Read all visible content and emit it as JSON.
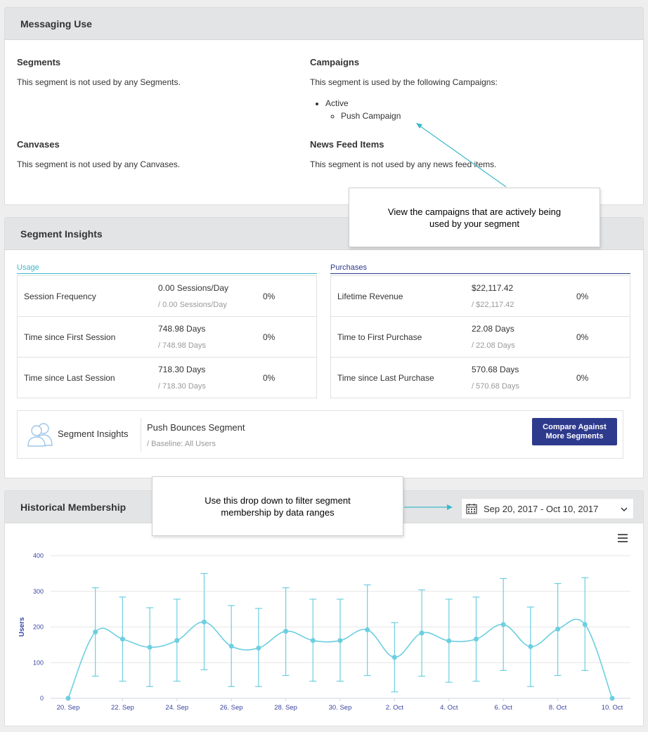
{
  "messaging_use": {
    "title": "Messaging Use",
    "segments": {
      "heading": "Segments",
      "text": "This segment is not used by any Segments."
    },
    "campaigns": {
      "heading": "Campaigns",
      "text": "This segment is used by the following Campaigns:",
      "status": "Active",
      "campaign_name": "Push Campaign"
    },
    "canvases": {
      "heading": "Canvases",
      "text": "This segment is not used by any Canvases."
    },
    "news_feed": {
      "heading": "News Feed Items",
      "text": "This segment is not used by any news feed items."
    }
  },
  "segment_insights": {
    "title": "Segment Insights",
    "usage_label": "Usage",
    "purchases_label": "Purchases",
    "usage_rows": [
      {
        "name": "Session Frequency",
        "value": "0.00 Sessions/Day",
        "baseline": "/ 0.00 Sessions/Day",
        "pct": "0%"
      },
      {
        "name": "Time since First Session",
        "value": "748.98 Days",
        "baseline": "/ 748.98 Days",
        "pct": "0%"
      },
      {
        "name": "Time since Last Session",
        "value": "718.30 Days",
        "baseline": "/ 718.30 Days",
        "pct": "0%"
      }
    ],
    "purchase_rows": [
      {
        "name": "Lifetime Revenue",
        "value": "$22,117.42",
        "baseline": "/ $22,117.42",
        "pct": "0%"
      },
      {
        "name": "Time to First Purchase",
        "value": "22.08 Days",
        "baseline": "/ 22.08 Days",
        "pct": "0%"
      },
      {
        "name": "Time since Last Purchase",
        "value": "570.68 Days",
        "baseline": "/ 570.68 Days",
        "pct": "0%"
      }
    ],
    "bar_label": "Segment Insights",
    "segment_name": "Push Bounces Segment",
    "baseline": "/ Baseline: All Users",
    "compare_button": "Compare Against More Segments"
  },
  "historical": {
    "title": "Historical Membership",
    "date_range": "Sep 20, 2017 - Oct 10, 2017"
  },
  "callouts": {
    "campaigns": "View the campaigns that are actively being used by your segment",
    "dropdown": "Use this drop down to filter segment membership by data ranges"
  },
  "icons": [
    "users-icon",
    "calendar-icon",
    "chevron-down-icon",
    "menu-icon"
  ],
  "colors": {
    "accent_teal": "#3bb9c9",
    "accent_navy": "#2e3a8c",
    "series": "#6ccfe0",
    "axis_text": "#3a45a0"
  },
  "chart_data": {
    "type": "line",
    "ylabel": "Users",
    "xlabel": "",
    "ylim": [
      0,
      400
    ],
    "yticks": [
      "0",
      "100",
      "200",
      "300",
      "400"
    ],
    "xticks": [
      "20. Sep",
      "22. Sep",
      "24. Sep",
      "26. Sep",
      "28. Sep",
      "30. Sep",
      "2. Oct",
      "4. Oct",
      "6. Oct",
      "8. Oct",
      "10. Oct"
    ],
    "x": [
      "Sep 20",
      "Sep 21",
      "Sep 22",
      "Sep 23",
      "Sep 24",
      "Sep 25",
      "Sep 26",
      "Sep 27",
      "Sep 28",
      "Sep 29",
      "Sep 30",
      "Oct 1",
      "Oct 2",
      "Oct 3",
      "Oct 4",
      "Oct 5",
      "Oct 6",
      "Oct 7",
      "Oct 8",
      "Oct 9",
      "Oct 10"
    ],
    "series": [
      {
        "values": [
          0,
          186,
          166,
          143,
          162,
          214,
          146,
          141,
          188,
          162,
          162,
          192,
          115,
          183,
          161,
          166,
          207,
          145,
          194,
          207,
          0
        ],
        "error_low": [
          null,
          62,
          48,
          33,
          48,
          80,
          33,
          33,
          64,
          48,
          48,
          64,
          18,
          62,
          45,
          48,
          78,
          33,
          64,
          78,
          null
        ],
        "error_high": [
          null,
          310,
          284,
          254,
          278,
          350,
          260,
          252,
          310,
          278,
          278,
          318,
          212,
          304,
          278,
          284,
          336,
          256,
          322,
          338,
          null
        ]
      }
    ],
    "grid": true,
    "legend": "none"
  }
}
